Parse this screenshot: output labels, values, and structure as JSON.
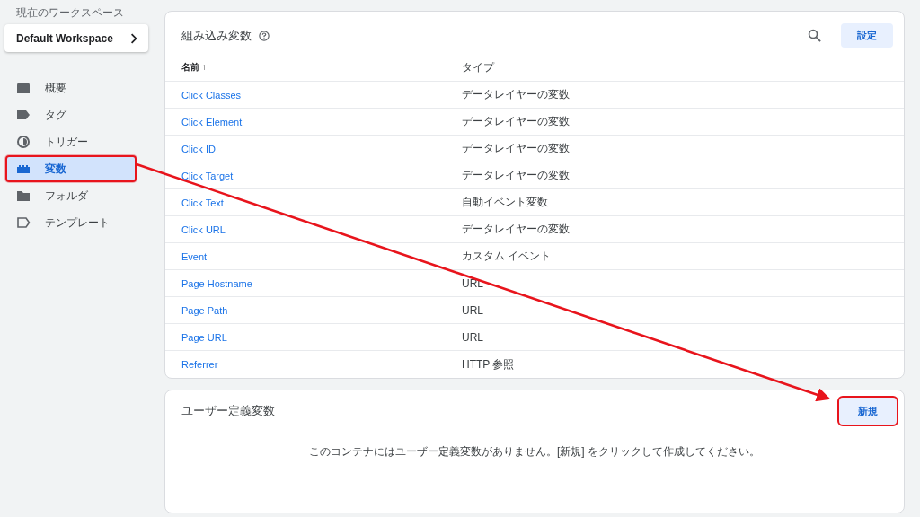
{
  "sidebar": {
    "workspace_label": "現在のワークスペース",
    "workspace": "Default Workspace",
    "items": [
      {
        "label": "概要",
        "selected": false,
        "highlighted": false
      },
      {
        "label": "タグ",
        "selected": false,
        "highlighted": false
      },
      {
        "label": "トリガー",
        "selected": false,
        "highlighted": false
      },
      {
        "label": "変数",
        "selected": true,
        "highlighted": true
      },
      {
        "label": "フォルダ",
        "selected": false,
        "highlighted": false
      },
      {
        "label": "テンプレート",
        "selected": false,
        "highlighted": false
      }
    ]
  },
  "builtin": {
    "title": "組み込み変数",
    "settings_button": "設定",
    "columns": [
      "名前 ↑",
      "タイプ"
    ],
    "rows": [
      [
        "Click Classes",
        "データレイヤーの変数"
      ],
      [
        "Click Element",
        "データレイヤーの変数"
      ],
      [
        "Click ID",
        "データレイヤーの変数"
      ],
      [
        "Click Target",
        "データレイヤーの変数"
      ],
      [
        "Click Text",
        "自動イベント変数"
      ],
      [
        "Click URL",
        "データレイヤーの変数"
      ],
      [
        "Event",
        "カスタム イベント"
      ],
      [
        "Page Hostname",
        "URL"
      ],
      [
        "Page Path",
        "URL"
      ],
      [
        "Page URL",
        "URL"
      ],
      [
        "Referrer",
        "HTTP 参照"
      ]
    ]
  },
  "user_defined": {
    "title": "ユーザー定義変数",
    "new_button": "新規",
    "new_button_highlighted": true,
    "empty_message": "このコンテナにはユーザー定義変数がありません。[新規] をクリックして作成してください。"
  }
}
